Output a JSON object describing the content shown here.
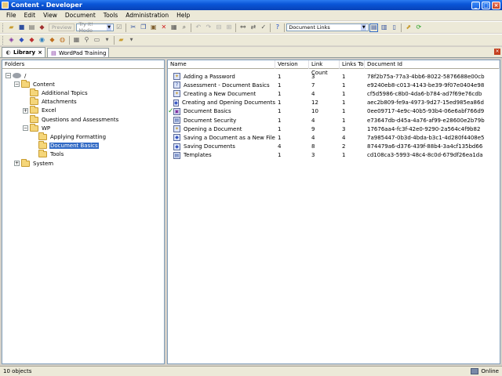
{
  "window": {
    "title": "Content - Developer",
    "minimize": "_",
    "maximize": "□",
    "close": "×"
  },
  "menu": [
    "File",
    "Edit",
    "View",
    "Document",
    "Tools",
    "Administration",
    "Help"
  ],
  "toolbar": {
    "preview_label": "Preview",
    "try_it_mode": "Try It! Mode",
    "view_combo": "Document Links"
  },
  "tabs": [
    {
      "label": "Library",
      "active": true,
      "close": "×"
    },
    {
      "label": "WordPad Training",
      "active": false
    }
  ],
  "folders": {
    "header": "Folders",
    "tree": [
      {
        "label": "/",
        "depth": 0,
        "type": "root",
        "expander": "−"
      },
      {
        "label": "Content",
        "depth": 1,
        "type": "folder",
        "expander": "−"
      },
      {
        "label": "Additional Topics",
        "depth": 2,
        "type": "folder",
        "expander": ""
      },
      {
        "label": "Attachments",
        "depth": 2,
        "type": "folder",
        "expander": ""
      },
      {
        "label": "Excel",
        "depth": 2,
        "type": "folder",
        "expander": "+"
      },
      {
        "label": "Questions and Assessments",
        "depth": 2,
        "type": "folder",
        "expander": ""
      },
      {
        "label": "WP",
        "depth": 2,
        "type": "folder",
        "expander": "−"
      },
      {
        "label": "Applying Formatting",
        "depth": 3,
        "type": "folder",
        "expander": ""
      },
      {
        "label": "Document Basics",
        "depth": 3,
        "type": "folder",
        "expander": "",
        "selected": true
      },
      {
        "label": "Tools",
        "depth": 3,
        "type": "folder",
        "expander": ""
      },
      {
        "label": "System",
        "depth": 1,
        "type": "folder",
        "expander": "+"
      }
    ]
  },
  "documents": {
    "columns": [
      "Name",
      "Version",
      "Link Count",
      "Links To",
      "Document Id"
    ],
    "rows": [
      {
        "name": "Adding a Password",
        "version": "1",
        "link_count": "3",
        "links_to": "1",
        "doc_id": "78f2b75a-77a3-4bb6-8022-5876688e00cb",
        "icon": "bulb-icon",
        "checked": false
      },
      {
        "name": "Assessment - Document Basics",
        "version": "1",
        "link_count": "7",
        "links_to": "1",
        "doc_id": "e9240eb8-c013-4143-be39-9f07e0404e98",
        "icon": "question-icon",
        "checked": false
      },
      {
        "name": "Creating a New Document",
        "version": "1",
        "link_count": "4",
        "links_to": "1",
        "doc_id": "cf5d5986-c8b0-4da6-b784-ad7f69e76cdb",
        "icon": "bulb-icon",
        "checked": false
      },
      {
        "name": "Creating and Opening Documents",
        "version": "1",
        "link_count": "12",
        "links_to": "1",
        "doc_id": "aec2b809-fe9a-4973-9d27-15ed985ea86d",
        "icon": "topic-icon",
        "checked": false
      },
      {
        "name": "Document Basics",
        "version": "1",
        "link_count": "10",
        "links_to": "1",
        "doc_id": "0ee09717-4e9c-40b5-93b4-06e6abf766d9",
        "icon": "module-icon",
        "checked": true
      },
      {
        "name": "Document Security",
        "version": "1",
        "link_count": "4",
        "links_to": "1",
        "doc_id": "e73647db-d45a-4a76-af99-e28600e2b79b",
        "icon": "page-icon",
        "checked": false
      },
      {
        "name": "Opening a Document",
        "version": "1",
        "link_count": "9",
        "links_to": "3",
        "doc_id": "17676aa4-fc3f-42e0-9290-2a564c4f9b82",
        "icon": "bulb-icon",
        "checked": false
      },
      {
        "name": "Saving a Document as a New File",
        "version": "1",
        "link_count": "4",
        "links_to": "4",
        "doc_id": "7a985447-0b3d-4bda-b3c1-4d280f4408e5",
        "icon": "topic-icon",
        "checked": false
      },
      {
        "name": "Saving Documents",
        "version": "4",
        "link_count": "8",
        "links_to": "2",
        "doc_id": "874479a6-d376-439f-88b4-3a4cf135bd66",
        "icon": "topic-icon",
        "checked": false
      },
      {
        "name": "Templates",
        "version": "1",
        "link_count": "3",
        "links_to": "1",
        "doc_id": "cd108ca3-5993-48c4-8c0d-679df26ea1da",
        "icon": "page-icon",
        "checked": false
      }
    ]
  },
  "status": {
    "left": "10 objects",
    "right": "Online"
  },
  "colors": {
    "title_bar": "#0a56d8",
    "selection": "#316ac5",
    "check": "#2aa02a",
    "chrome": "#ece9d8"
  }
}
